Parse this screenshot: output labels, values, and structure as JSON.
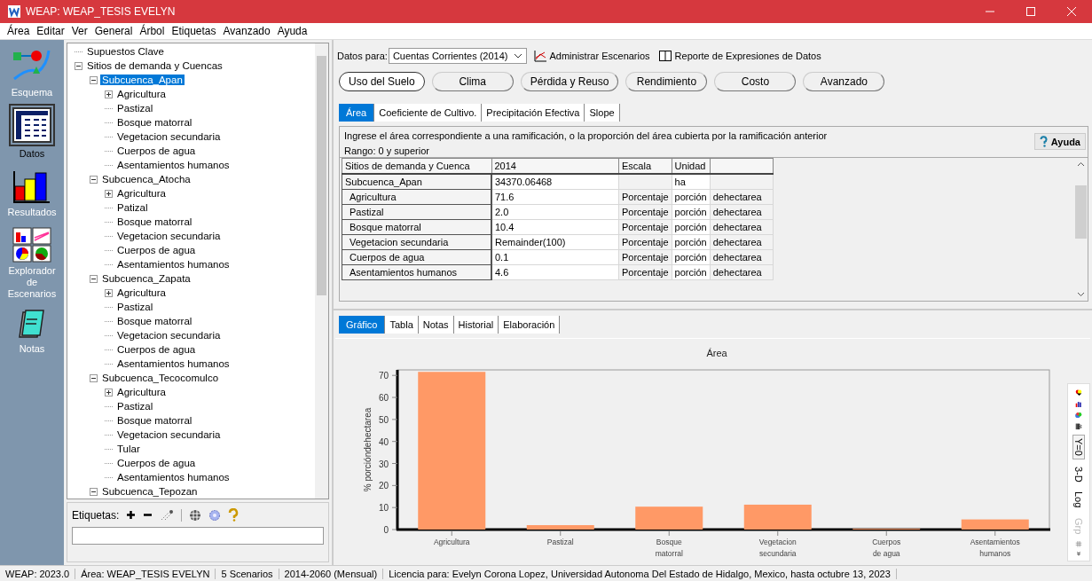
{
  "window": {
    "title": "WEAP: WEAP_TESIS EVELYN"
  },
  "menu": [
    "Área",
    "Editar",
    "Ver",
    "General",
    "Árbol",
    "Etiquetas",
    "Avanzado",
    "Ayuda"
  ],
  "nav": [
    {
      "label": "Esquema",
      "kind": "schematic",
      "selected": false
    },
    {
      "label": "Datos",
      "kind": "data",
      "selected": true
    },
    {
      "label": "Resultados",
      "kind": "results",
      "selected": false
    },
    {
      "label": "Explorador de Escenarios",
      "kind": "explorer",
      "selected": false
    },
    {
      "label": "Notas",
      "kind": "notes",
      "selected": false
    }
  ],
  "tree": {
    "items": [
      {
        "label": "Supuestos Clave",
        "selected": false
      },
      {
        "label": "Sitios de demanda y Cuencas",
        "expanded": true,
        "selected": false,
        "children": [
          {
            "label": "Subcuenca_Apan",
            "expanded": true,
            "selected": true,
            "children": [
              {
                "label": "Agricultura",
                "expanded": false,
                "selected": false
              },
              {
                "label": "Pastizal",
                "selected": false
              },
              {
                "label": "Bosque matorral",
                "selected": false
              },
              {
                "label": "Vegetacion secundaria",
                "selected": false
              },
              {
                "label": "Cuerpos de agua",
                "selected": false
              },
              {
                "label": "Asentamientos humanos",
                "selected": false
              }
            ]
          },
          {
            "label": "Subcuenca_Atocha",
            "expanded": true,
            "selected": false,
            "children": [
              {
                "label": "Agricultura",
                "expanded": false,
                "selected": false
              },
              {
                "label": "Patizal",
                "selected": false
              },
              {
                "label": "Bosque matorral",
                "selected": false
              },
              {
                "label": "Vegetacion secundaria",
                "selected": false
              },
              {
                "label": "Cuerpos de agua",
                "selected": false
              },
              {
                "label": "Asentamientos humanos",
                "selected": false
              }
            ]
          },
          {
            "label": "Subcuenca_Zapata",
            "expanded": true,
            "selected": false,
            "children": [
              {
                "label": "Agricultura",
                "expanded": false,
                "selected": false
              },
              {
                "label": "Pastizal",
                "selected": false
              },
              {
                "label": "Bosque matorral",
                "selected": false
              },
              {
                "label": "Vegetacion secundaria",
                "selected": false
              },
              {
                "label": "Cuerpos de agua",
                "selected": false
              },
              {
                "label": "Asentamientos humanos",
                "selected": false
              }
            ]
          },
          {
            "label": "Subcuenca_Tecocomulco",
            "expanded": true,
            "selected": false,
            "children": [
              {
                "label": "Agricultura",
                "expanded": false,
                "selected": false
              },
              {
                "label": "Pastizal",
                "selected": false
              },
              {
                "label": "Bosque matorral",
                "selected": false
              },
              {
                "label": "Vegetacion secundaria",
                "selected": false
              },
              {
                "label": "Tular",
                "selected": false
              },
              {
                "label": "Cuerpos de agua",
                "selected": false
              },
              {
                "label": "Asentamientos humanos",
                "selected": false
              }
            ]
          },
          {
            "label": "Subcuenca_Tepozan",
            "expanded": true,
            "selected": false
          }
        ]
      }
    ]
  },
  "tags": {
    "label": "Etiquetas:"
  },
  "toolbar": {
    "data_for_label": "Datos para:",
    "scenario": "Cuentas Corrientes (2014)",
    "manage": "Administrar Escenarios",
    "report": "Reporte de Expresiones de Datos"
  },
  "categories": [
    {
      "label": "Uso del Suelo",
      "selected": true
    },
    {
      "label": "Clima",
      "selected": false
    },
    {
      "label": "Pérdida y Reuso",
      "selected": false
    },
    {
      "label": "Rendimiento",
      "selected": false
    },
    {
      "label": "Costo",
      "selected": false
    },
    {
      "label": "Avanzado",
      "selected": false
    }
  ],
  "tabs": [
    {
      "label": "Área",
      "selected": true
    },
    {
      "label": "Coeficiente de Cultivo.",
      "selected": false
    },
    {
      "label": "Precipitación Efectiva",
      "selected": false
    },
    {
      "label": "Slope",
      "selected": false
    }
  ],
  "panel": {
    "description": "Ingrese el área correspondiente a una ramificación, o la proporción del área cubierta por la ramificación anterior",
    "range": "Rango: 0 y superior",
    "help": "Ayuda"
  },
  "table": {
    "columns": [
      "Sitios de demanda y Cuenca",
      "2014",
      "Escala",
      "Unidad"
    ],
    "rows": [
      {
        "kind": "parent",
        "cells": [
          "Subcuenca_Apan",
          "34370.06468",
          "",
          "ha",
          ""
        ]
      },
      {
        "kind": "child",
        "cells": [
          "Agricultura",
          "71.6",
          "Porcentaje",
          "porción",
          "dehectarea"
        ]
      },
      {
        "kind": "child",
        "cells": [
          "Pastizal",
          "2.0",
          "Porcentaje",
          "porción",
          "dehectarea"
        ]
      },
      {
        "kind": "child",
        "cells": [
          "Bosque matorral",
          "10.4",
          "Porcentaje",
          "porción",
          "dehectarea"
        ]
      },
      {
        "kind": "child",
        "cells": [
          "Vegetacion secundaria",
          "Remainder(100)",
          "Porcentaje",
          "porción",
          "dehectarea"
        ]
      },
      {
        "kind": "child",
        "cells": [
          "Cuerpos de agua",
          "0.1",
          "Porcentaje",
          "porción",
          "dehectarea"
        ]
      },
      {
        "kind": "child",
        "cells": [
          "Asentamientos humanos",
          "4.6",
          "Porcentaje",
          "porción",
          "dehectarea"
        ]
      }
    ]
  },
  "result_tabs": [
    {
      "label": "Gráfico",
      "selected": true
    },
    {
      "label": "Tabla",
      "selected": false
    },
    {
      "label": "Notas",
      "selected": false
    },
    {
      "label": "Historial",
      "selected": false
    },
    {
      "label": "Elaboración",
      "selected": false
    }
  ],
  "chart": {
    "chart_data": {
      "type": "bar",
      "title": "Área",
      "ylabel": "% porcióndehectarea",
      "categories": [
        "Agricultura",
        "Pastizal",
        "Bosque matorral",
        "Vegetacion secundaria",
        "Cuerpos de agua",
        "Asentamientos humanos"
      ],
      "series": [
        {
          "color": "#ff9966",
          "values": [
            71.6,
            2.0,
            10.4,
            11.3,
            0.1,
            4.6
          ]
        }
      ],
      "ylim": [
        0,
        72.5
      ],
      "yticks": [
        0,
        10,
        20,
        30,
        40,
        50,
        60,
        70
      ]
    }
  },
  "chart_toggles": [
    {
      "label": "Y=0",
      "selected": true,
      "disabled": false
    },
    {
      "label": "3-D",
      "selected": false,
      "disabled": false
    },
    {
      "label": "Log",
      "selected": false,
      "disabled": false
    },
    {
      "label": "Grp",
      "selected": false,
      "disabled": true
    }
  ],
  "status_bar": [
    "WEAP: 2023.0",
    "Área: WEAP_TESIS EVELYN",
    "5 Scenarios",
    "2014-2060 (Mensual)",
    "Licencia para: Evelyn Corona Lopez, Universidad Autonoma Del Estado de Hidalgo, Mexico, hasta octubre 13, 2023"
  ]
}
